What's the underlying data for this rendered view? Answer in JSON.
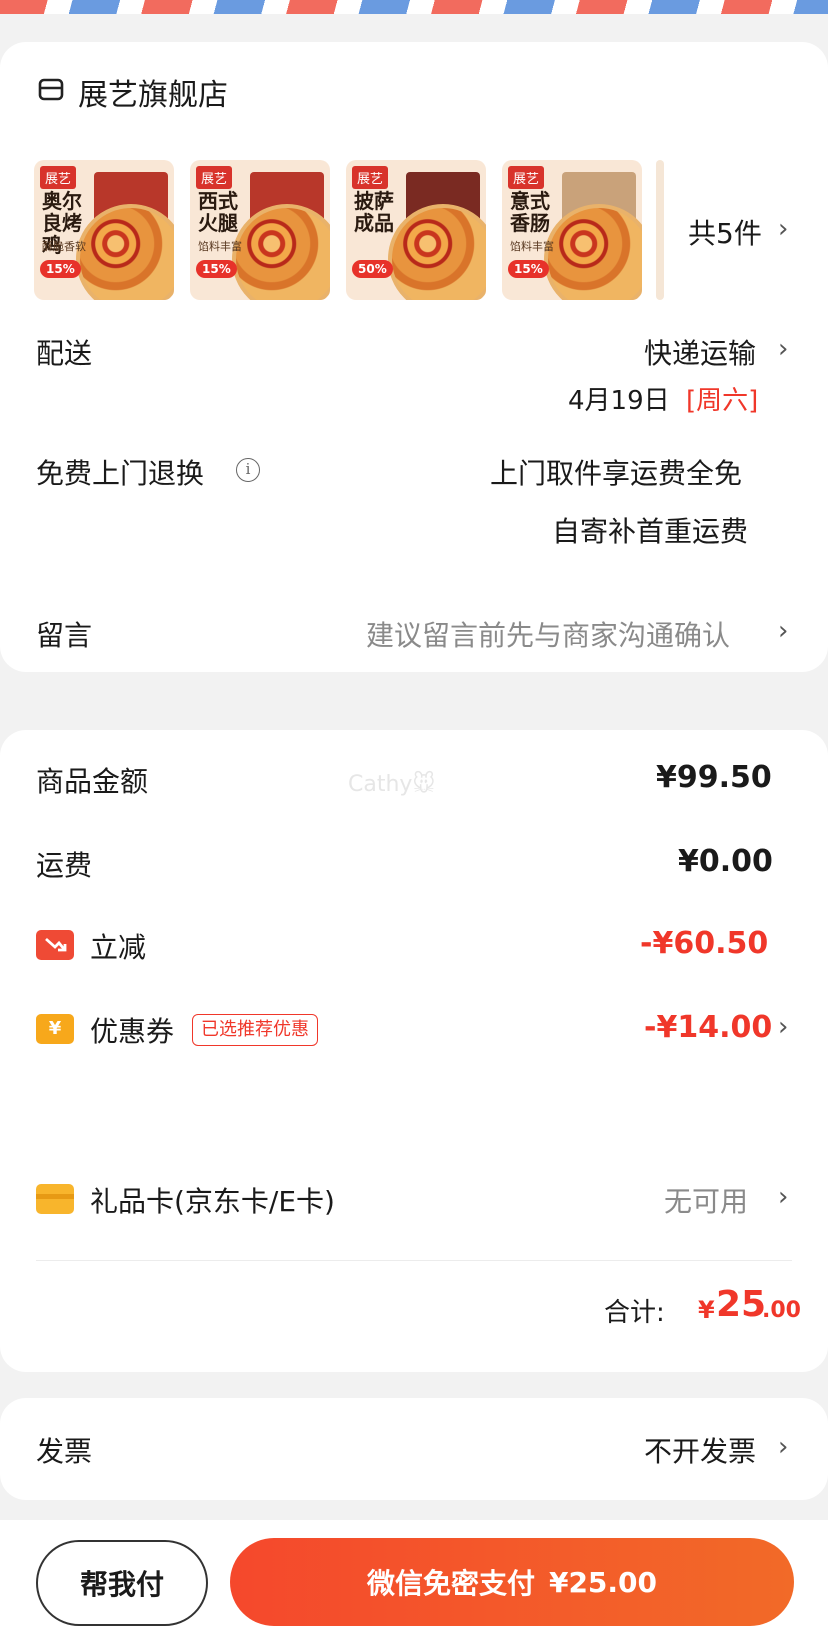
{
  "store": {
    "name": "展艺旗舰店",
    "icon": "store-icon"
  },
  "products": [
    {
      "brand": "展艺",
      "title": "奥尔良烤鸡",
      "sub": "酥脆香软",
      "badge": "15%"
    },
    {
      "brand": "展艺",
      "title": "西式火腿",
      "sub": "馅料丰富",
      "badge": "15%"
    },
    {
      "brand": "展艺",
      "title": "披萨成品",
      "sub": "",
      "badge": "50%"
    },
    {
      "brand": "展艺",
      "title": "意式香肠",
      "sub": "馅料丰富",
      "badge": "15%"
    }
  ],
  "product_count": "共5件",
  "delivery": {
    "label": "配送",
    "method": "快递运输",
    "date": "4月19日",
    "weekday": "[周六]"
  },
  "returns": {
    "label": "免费上门退换",
    "line1": "上门取件享运费全免",
    "line2": "自寄补首重运费"
  },
  "message": {
    "label": "留言",
    "placeholder": "建议留言前先与商家沟通确认"
  },
  "watermark": "Cathy🐭",
  "price": {
    "goods_label": "商品金额",
    "goods_value": "¥99.50",
    "shipping_label": "运费",
    "shipping_value": "¥0.00",
    "discount_label": "立减",
    "discount_value": "-¥60.50",
    "coupon_label": "优惠券",
    "coupon_tag": "已选推荐优惠",
    "coupon_value": "-¥14.00",
    "giftcard_label": "礼品卡(京东卡/E卡)",
    "giftcard_value": "无可用",
    "total_label": "合计:",
    "total_currency": "¥",
    "total_int": "25",
    "total_dec": ".00"
  },
  "invoice": {
    "label": "发票",
    "value": "不开发票"
  },
  "actions": {
    "help_pay": "帮我付",
    "pay_label": "微信免密支付",
    "pay_amount": "¥25.00"
  },
  "colors": {
    "accent": "#f0372a",
    "pay_gradient_start": "#f5482c",
    "pay_gradient_end": "#f26a28"
  }
}
